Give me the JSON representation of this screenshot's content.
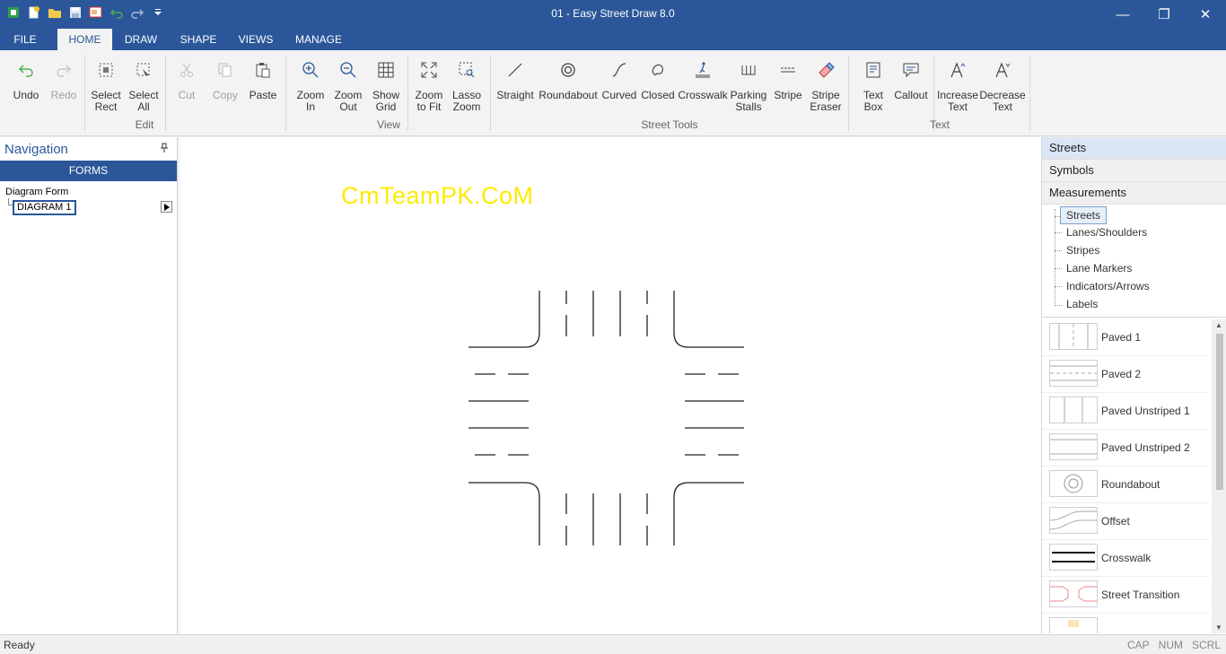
{
  "app": {
    "title": "01 - Easy Street Draw 8.0"
  },
  "window_controls": {
    "minimize": "—",
    "restore": "❐",
    "close": "✕"
  },
  "tabs": [
    {
      "label": "FILE"
    },
    {
      "label": "HOME"
    },
    {
      "label": "DRAW"
    },
    {
      "label": "SHAPE"
    },
    {
      "label": "VIEWS"
    },
    {
      "label": "MANAGE"
    }
  ],
  "active_tab": "HOME",
  "ribbon": {
    "buttons": {
      "undo": "Undo",
      "redo": "Redo",
      "select_rect": "Select\nRect",
      "select_all": "Select\nAll",
      "cut": "Cut",
      "copy": "Copy",
      "paste": "Paste",
      "zoom_in": "Zoom\nIn",
      "zoom_out": "Zoom\nOut",
      "show_grid": "Show\nGrid",
      "zoom_fit": "Zoom\nto Fit",
      "lasso_zoom": "Lasso\nZoom",
      "straight": "Straight",
      "roundabout": "Roundabout",
      "curved": "Curved",
      "closed": "Closed",
      "crosswalk": "Crosswalk",
      "parking_stalls": "Parking\nStalls",
      "stripe": "Stripe",
      "stripe_eraser": "Stripe\nEraser",
      "text_box": "Text\nBox",
      "callout": "Callout",
      "increase_text": "Increase\nText",
      "decrease_text": "Decrease\nText"
    },
    "groups": {
      "edit": "Edit",
      "view": "View",
      "street_tools": "Street Tools",
      "text": "Text"
    }
  },
  "navigation": {
    "title": "Navigation",
    "forms_label": "FORMS",
    "form_name": "Diagram Form",
    "diagram_item": "DIAGRAM 1"
  },
  "canvas": {
    "watermark": "CmTeamPK.CoM"
  },
  "right_panel": {
    "categories": [
      {
        "label": "Streets"
      },
      {
        "label": "Symbols"
      },
      {
        "label": "Measurements"
      }
    ],
    "active_category": "Streets",
    "subcategories": [
      {
        "label": "Streets"
      },
      {
        "label": "Lanes/Shoulders"
      },
      {
        "label": "Stripes"
      },
      {
        "label": "Lane Markers"
      },
      {
        "label": "Indicators/Arrows"
      },
      {
        "label": "Labels"
      }
    ],
    "selected_subcategory": "Streets",
    "library": [
      {
        "label": "Paved 1"
      },
      {
        "label": "Paved 2"
      },
      {
        "label": "Paved Unstriped 1"
      },
      {
        "label": "Paved Unstriped 2"
      },
      {
        "label": "Roundabout"
      },
      {
        "label": "Offset"
      },
      {
        "label": "Crosswalk"
      },
      {
        "label": "Street Transition"
      }
    ]
  },
  "status": {
    "left": "Ready",
    "cap": "CAP",
    "num": "NUM",
    "scrl": "SCRL"
  },
  "colors": {
    "accent": "#2b579a",
    "watermark": "#ffea00"
  }
}
